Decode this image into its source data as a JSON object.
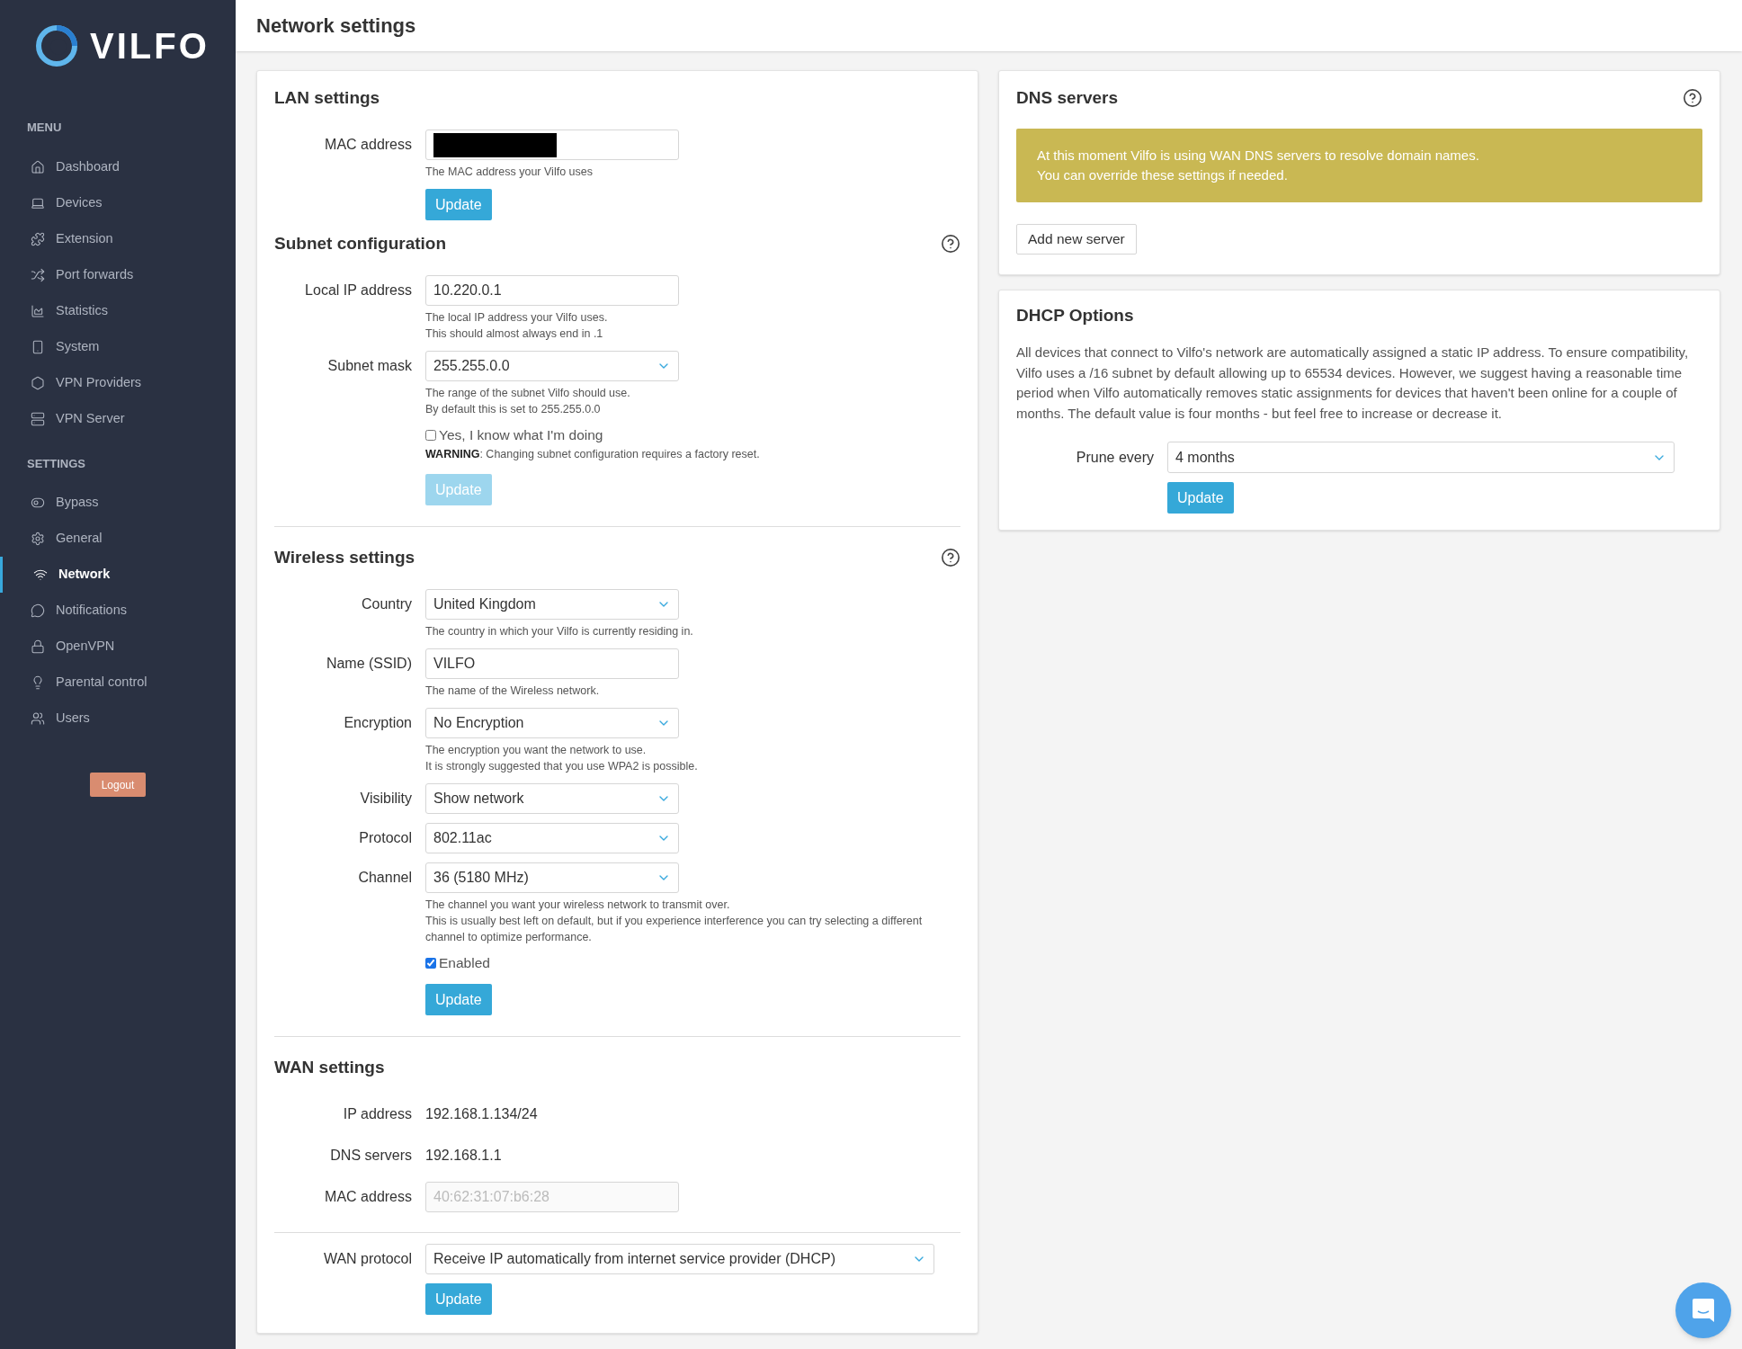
{
  "sidebar": {
    "logo_text": "VILFO",
    "sections": [
      {
        "heading": "MENU",
        "items": [
          {
            "label": "Dashboard",
            "selected": false
          },
          {
            "label": "Devices",
            "selected": false
          },
          {
            "label": "Extension",
            "selected": false
          },
          {
            "label": "Port forwards",
            "selected": false
          },
          {
            "label": "Statistics",
            "selected": false
          },
          {
            "label": "System",
            "selected": false
          },
          {
            "label": "VPN Providers",
            "selected": false
          },
          {
            "label": "VPN Server",
            "selected": false
          }
        ]
      },
      {
        "heading": "SETTINGS",
        "items": [
          {
            "label": "Bypass",
            "selected": false
          },
          {
            "label": "General",
            "selected": false
          },
          {
            "label": "Network",
            "selected": true
          },
          {
            "label": "Notifications",
            "selected": false
          },
          {
            "label": "OpenVPN",
            "selected": false
          },
          {
            "label": "Parental control",
            "selected": false
          },
          {
            "label": "Users",
            "selected": false
          }
        ]
      }
    ],
    "logout": "Logout"
  },
  "header": {
    "title": "Network settings"
  },
  "left_card": {
    "sections": [
      {
        "title": "LAN settings",
        "help": false,
        "separated": false,
        "rows": [
          {
            "kind": "input",
            "label": "MAC address",
            "redacted": true,
            "disabled": false,
            "hint": [
              "The MAC address your Vilfo uses"
            ]
          },
          {
            "kind": "button",
            "label": "Update",
            "disabled": false
          }
        ]
      },
      {
        "title": "Subnet configuration",
        "help": true,
        "separated": false,
        "rows": [
          {
            "kind": "input",
            "label": "Local IP address",
            "value": "10.220.0.1",
            "disabled": false,
            "hint": [
              "The local IP address your Vilfo uses.",
              "This should almost always end in .1"
            ]
          },
          {
            "kind": "select",
            "label": "Subnet mask",
            "value": "255.255.0.0",
            "hint": [
              "The range of the subnet Vilfo should use.",
              "By default this is set to 255.255.0.0"
            ]
          },
          {
            "kind": "checkbox",
            "label": "Yes, I know what I'm doing",
            "checked": false,
            "note": "**WARNING**: Changing subnet configuration requires a factory reset."
          },
          {
            "kind": "button",
            "label": "Update",
            "disabled": true
          }
        ]
      },
      {
        "title": "Wireless settings",
        "help": true,
        "separated": true,
        "rows": [
          {
            "kind": "select",
            "label": "Country",
            "value": "United Kingdom",
            "hint": [
              "The country in which your Vilfo is currently residing in."
            ]
          },
          {
            "kind": "input",
            "label": "Name (SSID)",
            "value": "VILFO",
            "disabled": false,
            "hint": [
              "The name of the Wireless network."
            ]
          },
          {
            "kind": "select",
            "label": "Encryption",
            "value": "No Encryption",
            "hint": [
              "The encryption you want the network to use.",
              "It is strongly suggested that you use WPA2 is possible."
            ]
          },
          {
            "kind": "select",
            "label": "Visibility",
            "value": "Show network"
          },
          {
            "kind": "select",
            "label": "Protocol",
            "value": "802.11ac"
          },
          {
            "kind": "select",
            "label": "Channel",
            "value": "36 (5180 MHz)",
            "hint": [
              "The channel you want your wireless network to transmit over.",
              "This is usually best left on default, but if you experience interference you can try selecting a different",
              "channel to optimize performance."
            ]
          },
          {
            "kind": "checkbox",
            "label": "Enabled",
            "checked": true
          },
          {
            "kind": "button",
            "label": "Update",
            "disabled": false
          }
        ]
      },
      {
        "title": "WAN settings",
        "help": false,
        "separated": true,
        "rows": [
          {
            "kind": "static",
            "label": "IP address",
            "value": "192.168.1.134/24"
          },
          {
            "kind": "static",
            "label": "DNS servers",
            "value": "192.168.1.1"
          },
          {
            "kind": "input",
            "label": "MAC address",
            "value": "40:62:31:07:b6:28",
            "disabled": true
          },
          {
            "kind": "divider"
          },
          {
            "kind": "select-wide",
            "label": "WAN protocol",
            "value": "Receive IP automatically from internet service provider (DHCP)"
          },
          {
            "kind": "button",
            "label": "Update",
            "disabled": false
          }
        ]
      }
    ]
  },
  "dns_card": {
    "title": "DNS servers",
    "help": true,
    "alert": [
      "At this moment Vilfo is using WAN DNS servers to resolve domain names.",
      "You can override these settings if needed."
    ],
    "button": "Add new server"
  },
  "dhcp_card": {
    "title": "DHCP Options",
    "text": "All devices that connect to Vilfo's network are automatically assigned a static IP address. To ensure compatibility, Vilfo uses a /16 subnet by default allowing up to 65534 devices. However, we suggest having a reasonable time period when Vilfo automatically removes static assignments for devices that haven't been online for a couple of months. The default value is four months - but feel free to increase or decrease it.",
    "prune_label": "Prune every",
    "prune_value": "4 months",
    "button": "Update"
  }
}
